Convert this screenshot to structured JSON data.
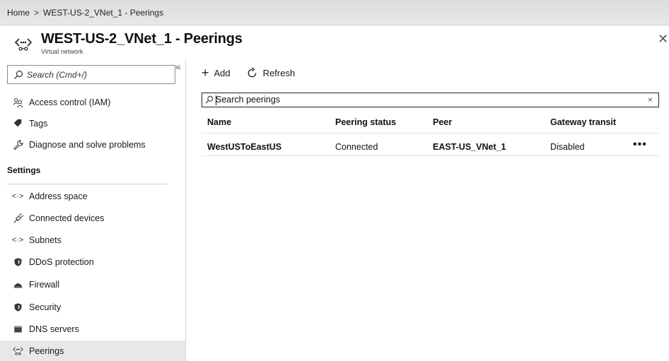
{
  "breadcrumb": {
    "home": "Home",
    "separator": ">",
    "current": "WEST-US-2_VNet_1 - Peerings"
  },
  "header": {
    "title": "WEST-US-2_VNet_1 - Peerings",
    "subtitle": "Virtual network",
    "icon": "peering-icon",
    "close": "✕"
  },
  "sidebar": {
    "search_placeholder": "Search (Cmd+/)",
    "collapse": "«",
    "top_items": [
      {
        "label": "Access control (IAM)",
        "icon": "people-icon"
      },
      {
        "label": "Tags",
        "icon": "tag-icon"
      },
      {
        "label": "Diagnose and solve problems",
        "icon": "wrench-icon"
      }
    ],
    "section": "Settings",
    "settings_items": [
      {
        "label": "Address space",
        "icon": "vnet-icon"
      },
      {
        "label": "Connected devices",
        "icon": "plug-icon"
      },
      {
        "label": "Subnets",
        "icon": "vnet-icon"
      },
      {
        "label": "DDoS protection",
        "icon": "shield-icon"
      },
      {
        "label": "Firewall",
        "icon": "firewall-icon"
      },
      {
        "label": "Security",
        "icon": "shield-icon"
      },
      {
        "label": "DNS servers",
        "icon": "server-icon"
      },
      {
        "label": "Peerings",
        "icon": "peering-icon",
        "active": true
      }
    ]
  },
  "toolbar": {
    "add_label": "Add",
    "refresh_label": "Refresh"
  },
  "grid": {
    "search_value": "Search peerings",
    "clear": "×",
    "columns": [
      "Name",
      "Peering status",
      "Peer",
      "Gateway transit"
    ],
    "rows": [
      {
        "name": "WestUSToEastUS",
        "status": "Connected",
        "peer": "EAST-US_VNet_1",
        "gateway_transit": "Disabled",
        "more": "•••"
      }
    ]
  }
}
